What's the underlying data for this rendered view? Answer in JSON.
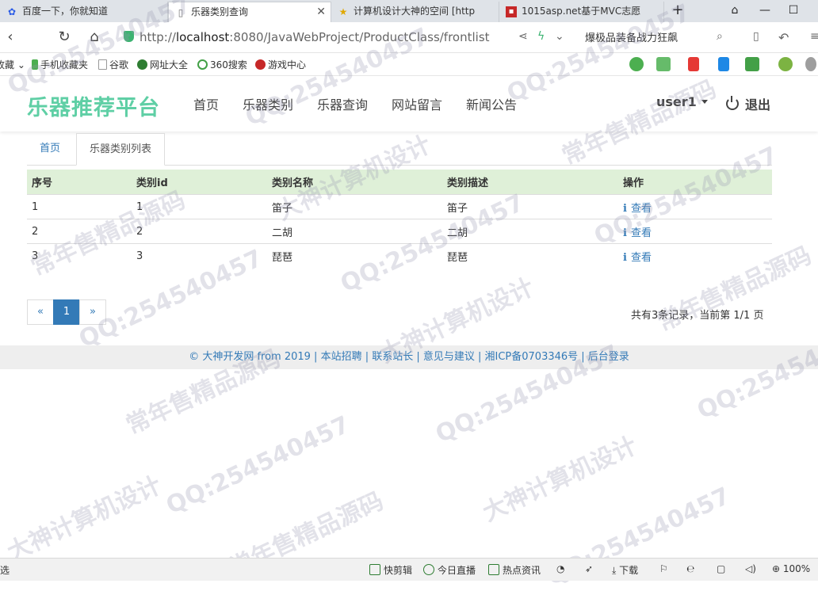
{
  "browser": {
    "tabs": [
      {
        "label": "百度一下，你就知道",
        "active": false
      },
      {
        "label": "乐器类别查询",
        "active": true
      },
      {
        "label": "计算机设计大神的空间 [http",
        "active": false
      },
      {
        "label": "1015asp.net基于MVC志愿",
        "active": false
      }
    ],
    "new_tab_symbol": "+",
    "url_prefix": "http://",
    "url_host": "localhost",
    "url_rest": ":8080/JavaWebProject/ProductClass/frontlist",
    "search_text": "爆极品装备战力狂飙",
    "bookmarks": [
      {
        "label": "收藏",
        "color": "#f0a020"
      },
      {
        "label": "手机收藏夹",
        "color": "#4caf50"
      },
      {
        "label": "谷歌",
        "color": "#999999"
      },
      {
        "label": "网址大全",
        "color": "#2e7d32"
      },
      {
        "label": "360搜索",
        "color": "#43a047"
      },
      {
        "label": "游戏中心",
        "color": "#c62828"
      }
    ]
  },
  "site": {
    "brand": "乐器推荐平台",
    "brand_color": "#5fcfa5",
    "nav": [
      "首页",
      "乐器类别",
      "乐器查询",
      "网站留言",
      "新闻公告"
    ],
    "user": "user1",
    "logout": "退出"
  },
  "breadcrumb": {
    "home": "首页",
    "current": "乐器类别列表"
  },
  "table": {
    "headers": [
      "序号",
      "类别id",
      "类别名称",
      "类别描述",
      "操作"
    ],
    "rows": [
      [
        "1",
        "1",
        "笛子",
        "笛子",
        "查看"
      ],
      [
        "2",
        "2",
        "二胡",
        "二胡",
        "查看"
      ],
      [
        "3",
        "3",
        "琵琶",
        "琵琶",
        "查看"
      ]
    ]
  },
  "pagination": {
    "prev": "«",
    "current": "1",
    "next": "»",
    "summary": "共有3条记录，当前第 1/1 页"
  },
  "footer": {
    "text": "© 大神开发网 from 2019 | 本站招聘 | 联系站长 | 意见与建议 | 湘ICP备0703346号 | 后台登录"
  },
  "statusbar": {
    "left": "选",
    "items": [
      "快剪辑",
      "今日直播",
      "热点资讯",
      "下载"
    ],
    "zoom": "100%"
  },
  "watermark": [
    "QQ:254540457",
    "常年售精品源码",
    "大神计算机设计"
  ]
}
